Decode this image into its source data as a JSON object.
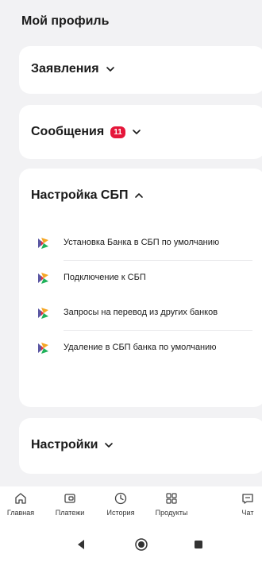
{
  "header": {
    "title": "Мой профиль"
  },
  "sections": {
    "applications": {
      "title": "Заявления"
    },
    "messages": {
      "title": "Сообщения",
      "badge": "11"
    },
    "sbp": {
      "title": "Настройка СБП",
      "items": [
        {
          "label": "Установка Банка в СБП по умолчанию"
        },
        {
          "label": "Подключение к СБП"
        },
        {
          "label": "Запросы на перевод из других банков"
        },
        {
          "label": "Удаление в СБП банка по умолчанию"
        }
      ]
    },
    "settings": {
      "title": "Настройки"
    }
  },
  "tabbar": {
    "items": [
      {
        "label": "Главная",
        "icon": "home-icon"
      },
      {
        "label": "Платежи",
        "icon": "wallet-icon"
      },
      {
        "label": "История",
        "icon": "clock-icon"
      },
      {
        "label": "Продукты",
        "icon": "grid-icon"
      },
      {
        "label": "Чат",
        "icon": "chat-icon"
      }
    ]
  },
  "system_nav": {
    "icons": [
      "back-icon",
      "home-circle-icon",
      "recents-icon"
    ]
  },
  "colors": {
    "badge": "#e5163a",
    "background": "#f2f2f4",
    "card": "#ffffff"
  }
}
